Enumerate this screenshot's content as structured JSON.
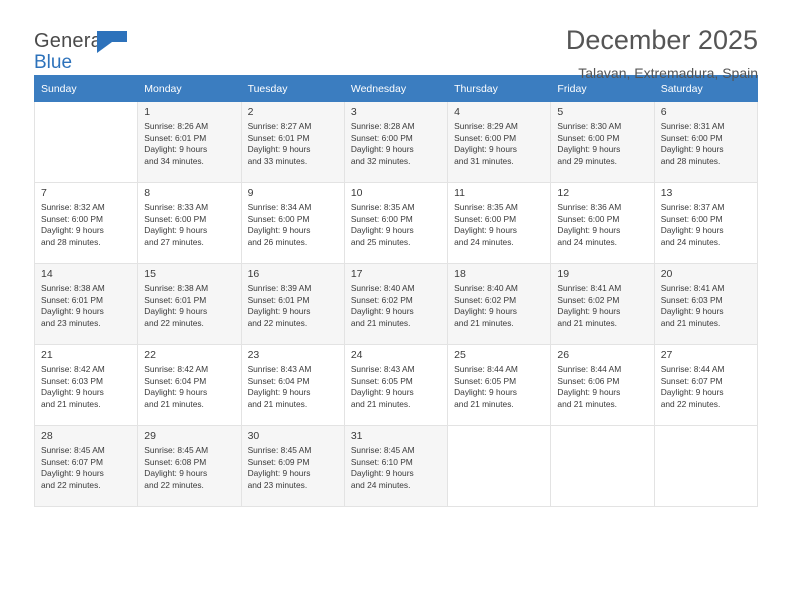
{
  "logo": {
    "line1": "General",
    "line2": "Blue",
    "icon": "flag-icon"
  },
  "header": {
    "title": "December 2025",
    "subtitle": "Talavan, Extremadura, Spain"
  },
  "calendar": {
    "weekday_headers": [
      "Sunday",
      "Monday",
      "Tuesday",
      "Wednesday",
      "Thursday",
      "Friday",
      "Saturday"
    ],
    "weeks": [
      [
        {
          "day": "",
          "lines": []
        },
        {
          "day": "1",
          "lines": [
            "Sunrise: 8:26 AM",
            "Sunset: 6:01 PM",
            "Daylight: 9 hours",
            "and 34 minutes."
          ]
        },
        {
          "day": "2",
          "lines": [
            "Sunrise: 8:27 AM",
            "Sunset: 6:01 PM",
            "Daylight: 9 hours",
            "and 33 minutes."
          ]
        },
        {
          "day": "3",
          "lines": [
            "Sunrise: 8:28 AM",
            "Sunset: 6:00 PM",
            "Daylight: 9 hours",
            "and 32 minutes."
          ]
        },
        {
          "day": "4",
          "lines": [
            "Sunrise: 8:29 AM",
            "Sunset: 6:00 PM",
            "Daylight: 9 hours",
            "and 31 minutes."
          ]
        },
        {
          "day": "5",
          "lines": [
            "Sunrise: 8:30 AM",
            "Sunset: 6:00 PM",
            "Daylight: 9 hours",
            "and 29 minutes."
          ]
        },
        {
          "day": "6",
          "lines": [
            "Sunrise: 8:31 AM",
            "Sunset: 6:00 PM",
            "Daylight: 9 hours",
            "and 28 minutes."
          ]
        }
      ],
      [
        {
          "day": "7",
          "lines": [
            "Sunrise: 8:32 AM",
            "Sunset: 6:00 PM",
            "Daylight: 9 hours",
            "and 28 minutes."
          ]
        },
        {
          "day": "8",
          "lines": [
            "Sunrise: 8:33 AM",
            "Sunset: 6:00 PM",
            "Daylight: 9 hours",
            "and 27 minutes."
          ]
        },
        {
          "day": "9",
          "lines": [
            "Sunrise: 8:34 AM",
            "Sunset: 6:00 PM",
            "Daylight: 9 hours",
            "and 26 minutes."
          ]
        },
        {
          "day": "10",
          "lines": [
            "Sunrise: 8:35 AM",
            "Sunset: 6:00 PM",
            "Daylight: 9 hours",
            "and 25 minutes."
          ]
        },
        {
          "day": "11",
          "lines": [
            "Sunrise: 8:35 AM",
            "Sunset: 6:00 PM",
            "Daylight: 9 hours",
            "and 24 minutes."
          ]
        },
        {
          "day": "12",
          "lines": [
            "Sunrise: 8:36 AM",
            "Sunset: 6:00 PM",
            "Daylight: 9 hours",
            "and 24 minutes."
          ]
        },
        {
          "day": "13",
          "lines": [
            "Sunrise: 8:37 AM",
            "Sunset: 6:00 PM",
            "Daylight: 9 hours",
            "and 24 minutes."
          ]
        }
      ],
      [
        {
          "day": "14",
          "lines": [
            "Sunrise: 8:38 AM",
            "Sunset: 6:01 PM",
            "Daylight: 9 hours",
            "and 23 minutes."
          ]
        },
        {
          "day": "15",
          "lines": [
            "Sunrise: 8:38 AM",
            "Sunset: 6:01 PM",
            "Daylight: 9 hours",
            "and 22 minutes."
          ]
        },
        {
          "day": "16",
          "lines": [
            "Sunrise: 8:39 AM",
            "Sunset: 6:01 PM",
            "Daylight: 9 hours",
            "and 22 minutes."
          ]
        },
        {
          "day": "17",
          "lines": [
            "Sunrise: 8:40 AM",
            "Sunset: 6:02 PM",
            "Daylight: 9 hours",
            "and 21 minutes."
          ]
        },
        {
          "day": "18",
          "lines": [
            "Sunrise: 8:40 AM",
            "Sunset: 6:02 PM",
            "Daylight: 9 hours",
            "and 21 minutes."
          ]
        },
        {
          "day": "19",
          "lines": [
            "Sunrise: 8:41 AM",
            "Sunset: 6:02 PM",
            "Daylight: 9 hours",
            "and 21 minutes."
          ]
        },
        {
          "day": "20",
          "lines": [
            "Sunrise: 8:41 AM",
            "Sunset: 6:03 PM",
            "Daylight: 9 hours",
            "and 21 minutes."
          ]
        }
      ],
      [
        {
          "day": "21",
          "lines": [
            "Sunrise: 8:42 AM",
            "Sunset: 6:03 PM",
            "Daylight: 9 hours",
            "and 21 minutes."
          ]
        },
        {
          "day": "22",
          "lines": [
            "Sunrise: 8:42 AM",
            "Sunset: 6:04 PM",
            "Daylight: 9 hours",
            "and 21 minutes."
          ]
        },
        {
          "day": "23",
          "lines": [
            "Sunrise: 8:43 AM",
            "Sunset: 6:04 PM",
            "Daylight: 9 hours",
            "and 21 minutes."
          ]
        },
        {
          "day": "24",
          "lines": [
            "Sunrise: 8:43 AM",
            "Sunset: 6:05 PM",
            "Daylight: 9 hours",
            "and 21 minutes."
          ]
        },
        {
          "day": "25",
          "lines": [
            "Sunrise: 8:44 AM",
            "Sunset: 6:05 PM",
            "Daylight: 9 hours",
            "and 21 minutes."
          ]
        },
        {
          "day": "26",
          "lines": [
            "Sunrise: 8:44 AM",
            "Sunset: 6:06 PM",
            "Daylight: 9 hours",
            "and 21 minutes."
          ]
        },
        {
          "day": "27",
          "lines": [
            "Sunrise: 8:44 AM",
            "Sunset: 6:07 PM",
            "Daylight: 9 hours",
            "and 22 minutes."
          ]
        }
      ],
      [
        {
          "day": "28",
          "lines": [
            "Sunrise: 8:45 AM",
            "Sunset: 6:07 PM",
            "Daylight: 9 hours",
            "and 22 minutes."
          ]
        },
        {
          "day": "29",
          "lines": [
            "Sunrise: 8:45 AM",
            "Sunset: 6:08 PM",
            "Daylight: 9 hours",
            "and 22 minutes."
          ]
        },
        {
          "day": "30",
          "lines": [
            "Sunrise: 8:45 AM",
            "Sunset: 6:09 PM",
            "Daylight: 9 hours",
            "and 23 minutes."
          ]
        },
        {
          "day": "31",
          "lines": [
            "Sunrise: 8:45 AM",
            "Sunset: 6:10 PM",
            "Daylight: 9 hours",
            "and 24 minutes."
          ]
        },
        {
          "day": "",
          "lines": []
        },
        {
          "day": "",
          "lines": []
        },
        {
          "day": "",
          "lines": []
        }
      ]
    ]
  },
  "colors": {
    "header_blue": "#3b7dc0",
    "logo_blue": "#2d72bb",
    "shaded_row": "#f6f6f6",
    "grid_line": "#e3e3e3"
  }
}
